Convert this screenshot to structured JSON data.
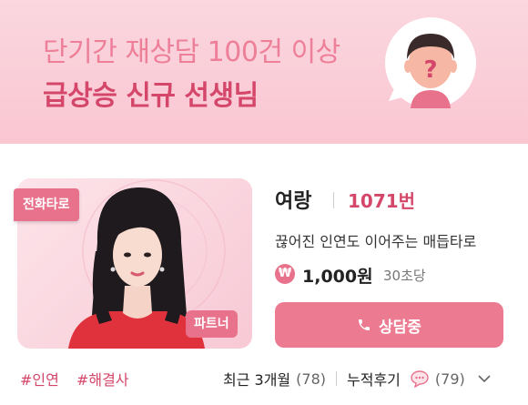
{
  "banner": {
    "line1": "단기간 재상담 100건 이상",
    "line2": "급상승 신규 선생님",
    "question_mark": "?"
  },
  "card": {
    "tag_top": "전화타로",
    "tag_bottom": "파트너",
    "name": "여랑",
    "number": "1071번",
    "description": "끊어진 인연도 이어주는 매듭타로",
    "won_symbol": "₩",
    "price": "1,000원",
    "per_unit": "30초당",
    "consult_button": "상담중",
    "hashtags": [
      "#인연",
      "#해결사"
    ],
    "recent_label": "최근 3개월",
    "recent_count": "(78)",
    "review_label": "누적후기",
    "review_count": "(79)"
  },
  "colors": {
    "accent": "#d4476a",
    "button": "#ec7a91",
    "banner_bg": "#f9c6d2"
  },
  "icons": [
    "person-question-icon",
    "phone-icon",
    "won-icon",
    "chat-bubble-icon",
    "chevron-down-icon"
  ]
}
